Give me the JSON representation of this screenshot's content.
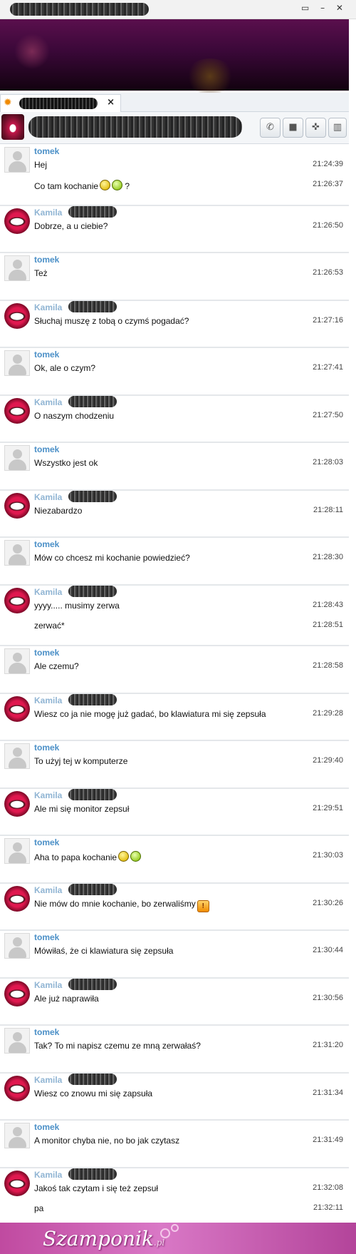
{
  "window": {
    "controls": "▭ – ✕"
  },
  "tab": {
    "close": "×"
  },
  "toolbar": {
    "call_icon": "phone-icon",
    "video_icon": "video-camera-icon",
    "game_icon": "gamepad-icon",
    "gift_icon": "gift-icon",
    "call_glyph": "✆",
    "video_glyph": "■",
    "game_glyph": "✜",
    "gift_glyph": "▥"
  },
  "messages": [
    {
      "sender": "tomek",
      "lines": [
        {
          "text": "Hej",
          "time": "21:24:39"
        },
        {
          "text": "Co tam kochanie",
          "time": "21:26:37",
          "emoji": [
            "smiley",
            "smiley-green"
          ],
          "after": " ?"
        }
      ]
    },
    {
      "sender": "Kamila",
      "lines": [
        {
          "text": "Dobrze, a u ciebie?",
          "time": "21:26:50"
        }
      ]
    },
    {
      "sender": "tomek",
      "lines": [
        {
          "text": "Też",
          "time": "21:26:53"
        }
      ]
    },
    {
      "sender": "Kamila",
      "lines": [
        {
          "text": "Słuchaj muszę z tobą o czymś pogadać?",
          "time": "21:27:16"
        }
      ]
    },
    {
      "sender": "tomek",
      "lines": [
        {
          "text": "Ok, ale o czym?",
          "time": "21:27:41"
        }
      ]
    },
    {
      "sender": "Kamila",
      "lines": [
        {
          "text": "O naszym chodzeniu",
          "time": "21:27:50"
        }
      ]
    },
    {
      "sender": "tomek",
      "lines": [
        {
          "text": "Wszystko jest ok",
          "time": "21:28:03"
        }
      ]
    },
    {
      "sender": "Kamila",
      "lines": [
        {
          "text": "Niezabardzo",
          "time": "21:28:11"
        }
      ]
    },
    {
      "sender": "tomek",
      "lines": [
        {
          "text": "Mów co chcesz mi kochanie powiedzieć?",
          "time": "21:28:30"
        }
      ]
    },
    {
      "sender": "Kamila",
      "lines": [
        {
          "text": "yyyy..... musimy zerwa",
          "time": "21:28:43"
        },
        {
          "text": "zerwać*",
          "time": "21:28:51"
        }
      ]
    },
    {
      "sender": "tomek",
      "lines": [
        {
          "text": "Ale czemu?",
          "time": "21:28:58"
        }
      ]
    },
    {
      "sender": "Kamila",
      "lines": [
        {
          "text": "Wiesz co ja nie mogę już gadać, bo klawiatura mi się zepsuła",
          "time": "21:29:28"
        }
      ]
    },
    {
      "sender": "tomek",
      "lines": [
        {
          "text": "To użyj tej w komputerze",
          "time": "21:29:40"
        }
      ]
    },
    {
      "sender": "Kamila",
      "lines": [
        {
          "text": "Ale mi się monitor zepsuł",
          "time": "21:29:51"
        }
      ]
    },
    {
      "sender": "tomek",
      "lines": [
        {
          "text": "Aha to papa kochanie",
          "time": "21:30:03",
          "emoji": [
            "smiley",
            "smiley-green"
          ]
        }
      ]
    },
    {
      "sender": "Kamila",
      "lines": [
        {
          "text": "Nie mów do mnie kochanie, bo zerwaliśmy",
          "time": "21:30:26",
          "emoji": [
            "exclamation"
          ]
        }
      ]
    },
    {
      "sender": "tomek",
      "lines": [
        {
          "text": "Mówiłaś, że ci klawiatura się zepsuła",
          "time": "21:30:44"
        }
      ]
    },
    {
      "sender": "Kamila",
      "lines": [
        {
          "text": "Ale już naprawiła",
          "time": "21:30:56"
        }
      ]
    },
    {
      "sender": "tomek",
      "lines": [
        {
          "text": "Tak? To mi napisz czemu ze mną zerwałaś?",
          "time": "21:31:20"
        }
      ]
    },
    {
      "sender": "Kamila",
      "lines": [
        {
          "text": "Wiesz co znowu mi się zapsuła",
          "time": "21:31:34"
        }
      ]
    },
    {
      "sender": "tomek",
      "lines": [
        {
          "text": "A monitor chyba nie, no bo jak czytasz",
          "time": "21:31:49"
        }
      ]
    },
    {
      "sender": "Kamila",
      "lines": [
        {
          "text": "Jakoś tak czytam i się też zepsuł",
          "time": "21:32:08"
        },
        {
          "text": "pa",
          "time": "21:32:11"
        }
      ]
    }
  ],
  "footer": {
    "logo": "Szamponik",
    "logo_suffix": ".pl"
  }
}
